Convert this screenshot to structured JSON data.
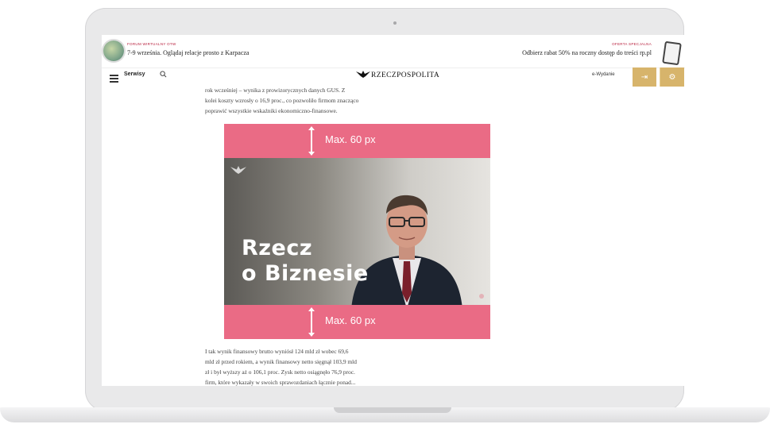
{
  "promo": {
    "left_tag": "FORUM WIRTUALNY OTW",
    "left_text": "7-9 września. Oglądaj relacje prosto z Karpacza",
    "right_tag": "OFERTA SPECJALNA",
    "right_text": "Odbierz rabat 50% na roczny dostęp do treści rp.pl"
  },
  "nav": {
    "menu_label": "Serwisy",
    "logo_text": "RZECZPOSPOLITA",
    "edition_label": "e-Wydanie",
    "login_icon": "login-icon",
    "settings_icon": "gear-icon"
  },
  "article": {
    "para1": [
      "rok wcześniej – wynika z prowizorycznych danych GUS. Z",
      "kolei koszty wzrosły o 16,9 proc., co pozwoliło firmom znacząco",
      "poprawić wszystkie wskaźniki ekonomiczno-finansowe."
    ],
    "para2": [
      "I tak wynik finansowy brutto wyniósł 124 mld zł wobec 69,6",
      "mld zł przed rokiem, a wynik finansowy netto sięgnął 103,9 mld",
      "zł i był wyższy aż o 106,1 proc. Zysk netto osiągnęło 76,9 proc.",
      "firm, które wykazały w swoich sprawozdaniach łącznie ponad..."
    ]
  },
  "ad": {
    "band_top_label": "Max. 60 px",
    "band_bottom_label": "Max. 60 px",
    "video_title_line1": "Rzecz",
    "video_title_line2": "o Biznesie"
  },
  "colors": {
    "band": "#ea6b85",
    "gold": "#d7b46b",
    "promo_red": "#b71c3a"
  }
}
